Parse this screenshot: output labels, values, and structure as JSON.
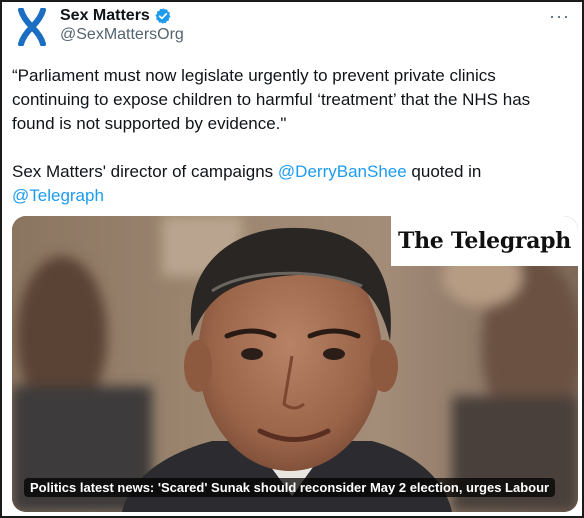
{
  "account": {
    "display_name": "Sex Matters",
    "handle": "@SexMattersOrg",
    "logo_icon": "chromosome-x-logo-icon",
    "verified_icon": "verified-badge-icon",
    "logo_color": "#1b6ec2",
    "verified_color": "#1d9bf0"
  },
  "menu": {
    "more_label": "···",
    "more_icon": "more-options-icon"
  },
  "tweet": {
    "quote": "“Parliament must now legislate urgently to prevent private clinics continuing to expose children to harmful ‘treatment’ that the NHS has found is not supported by evidence.\"",
    "attribution_prefix": "Sex Matters' director of campaigns ",
    "mention_1": "@DerryBanShee",
    "attribution_middle": " quoted in",
    "mention_2": "@Telegraph"
  },
  "link_card": {
    "publisher_masthead": "The Telegraph",
    "headline": "Politics latest news: 'Scared' Sunak should reconsider May 2 election, urges Labour"
  },
  "colors": {
    "link": "#1d9bf0",
    "text": "#0f1419",
    "secondary": "#536471"
  }
}
